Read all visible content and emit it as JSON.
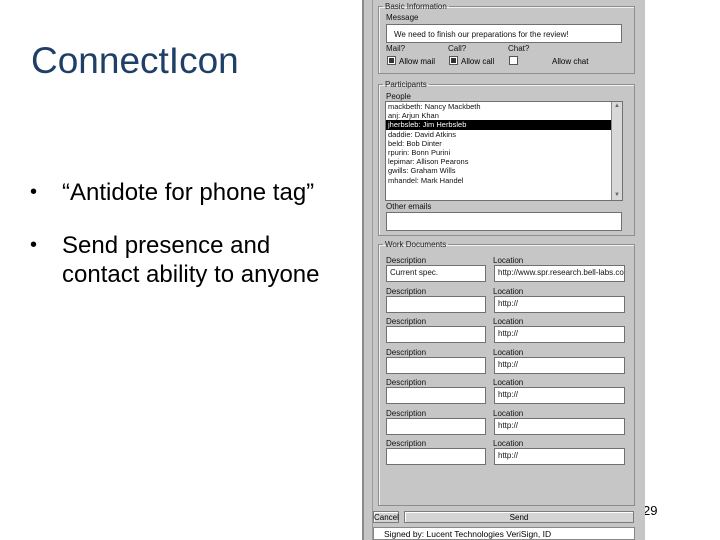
{
  "slide": {
    "title": "ConnectIcon",
    "bullets": [
      "“Antidote for phone tag”",
      "Send presence and contact ability to anyone"
    ],
    "page_number": "29"
  },
  "applet": {
    "basic": {
      "legend": "Basic Information",
      "message_label": "Message",
      "message_value": "We need to finish our preparations for the review!",
      "mail_label": "Mail?",
      "call_label": "Call?",
      "chat_label": "Chat?",
      "allow_mail": "Allow mail",
      "allow_call": "Allow call",
      "allow_chat": "Allow chat"
    },
    "participants": {
      "legend": "Participants",
      "people_label": "People",
      "people": [
        "mackbeth: Nancy Mackbeth",
        "anj: Arjun Khan",
        "jherbsleb: Jim Herbsleb",
        "daddie: David Atkins",
        "beld: Bob Dinter",
        "rpurin: Bonn Purini",
        "lepimar: Allison Pearons",
        "gwills: Graham Wills",
        "mhandel: Mark Handel"
      ],
      "selected_index": 2,
      "other_emails_label": "Other emails"
    },
    "documents": {
      "legend": "Work Documents",
      "description_label": "Description",
      "location_label": "Location",
      "rows": [
        {
          "description": "Current spec.",
          "location": "http://www.spr.research.bell-labs.com"
        },
        {
          "description": "",
          "location": "http://"
        },
        {
          "description": "",
          "location": "http://"
        },
        {
          "description": "",
          "location": "http://"
        },
        {
          "description": "",
          "location": "http://"
        },
        {
          "description": "",
          "location": "http://"
        },
        {
          "description": "",
          "location": "http://"
        }
      ]
    },
    "bottom": {
      "cancel_label": "Cancel",
      "send_label": "Send",
      "status_text": "Signed by: Lucent Technologies VeriSign, ID"
    }
  }
}
